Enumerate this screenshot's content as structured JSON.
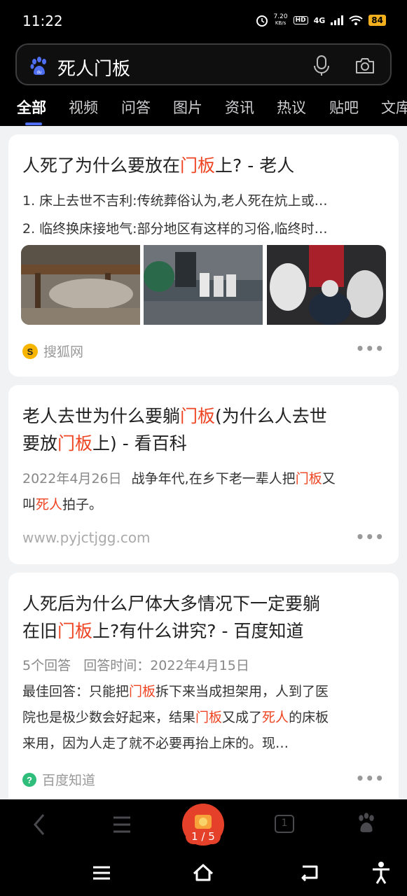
{
  "status_bar": {
    "time": "11:22",
    "net_speed_value": "7.20",
    "net_speed_unit": "KB/s",
    "hd_badge": "HD",
    "network": "4G",
    "battery": "84"
  },
  "search": {
    "query": "死人门板"
  },
  "tabs": [
    {
      "label": "全部"
    },
    {
      "label": "视频"
    },
    {
      "label": "问答"
    },
    {
      "label": "图片"
    },
    {
      "label": "资讯"
    },
    {
      "label": "热议"
    },
    {
      "label": "贴吧"
    },
    {
      "label": "文库"
    }
  ],
  "results": [
    {
      "title_pre": "人死了为什么要放在",
      "title_hl": "门板",
      "title_post": "上? - 老人",
      "line1": "1. 床上去世不吉利:传统葬俗认为,老人死在炕上或…",
      "line2": "2. 临终换床接地气:部分地区有这样的习俗,临终时…",
      "source": "搜狐网",
      "more": "•••"
    },
    {
      "title_a": "老人去世为什么要躺",
      "title_hl1": "门板",
      "title_b": "(为什么人去世",
      "title_c": "要放",
      "title_hl2": "门板",
      "title_d": "上) - 看百科",
      "date": "2022年4月26日",
      "snippet_a": "战争年代,在乡下老一辈人把",
      "snippet_hl1": "门板",
      "snippet_b": "又",
      "snippet_c": "叫",
      "snippet_hl2": "死人",
      "snippet_d": "拍子。",
      "url": "www.pyjctjgg.com",
      "more": "•••"
    },
    {
      "title_a": "人死后为什么尸体大多情况下一定要躺",
      "title_b": "在旧",
      "title_hl": "门板",
      "title_c": "上?有什么讲究? - 百度知道",
      "meta": "5个回答   回答时间：2022年4月15日",
      "ans_a": "最佳回答：只能把",
      "ans_hl1": "门板",
      "ans_b": "拆下来当成担架用，人到了医",
      "ans_c": "院也是极少数会好起来，结果",
      "ans_hl2": "门板",
      "ans_d": "又成了",
      "ans_hl3": "死人",
      "ans_e": "的床板",
      "ans_f": "来用，因为人走了就不必要再抬上床的。现…",
      "source": "百度知道",
      "more": "•••"
    }
  ],
  "app_bar": {
    "pager": "1 / 5",
    "tab_count": "1"
  },
  "colors": {
    "accent": "#4e6ef2",
    "highlight": "#ee4422",
    "pager": "#e4402a"
  }
}
